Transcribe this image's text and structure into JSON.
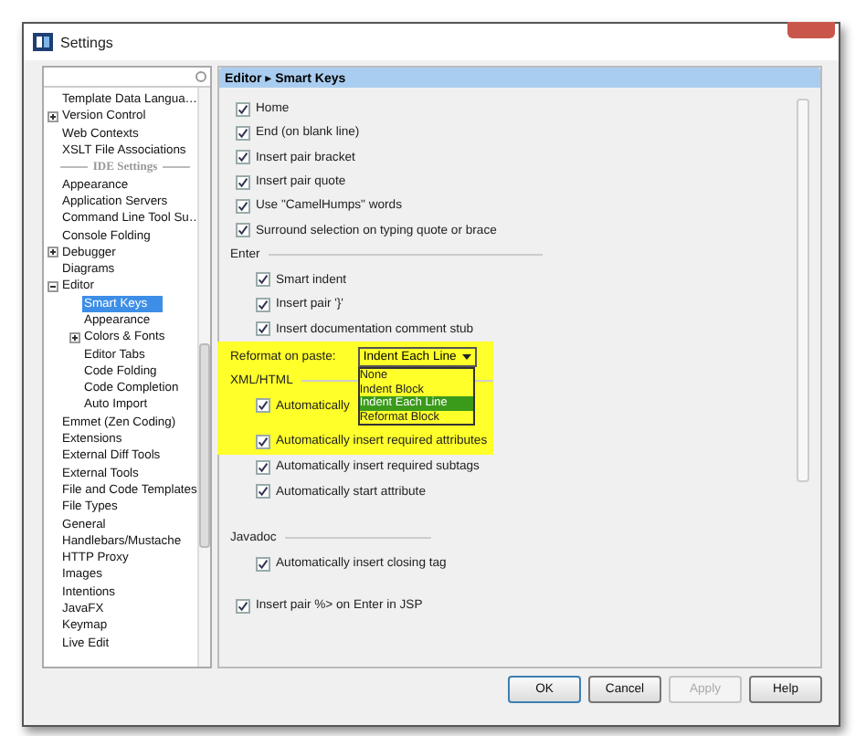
{
  "window": {
    "title": "Settings"
  },
  "sidebar": {
    "items": [
      {
        "kind": "item",
        "label": "Template Data Langua…",
        "selected": false
      },
      {
        "kind": "item",
        "label": "Version Control",
        "selected": false,
        "expanded": false,
        "has_children": true
      },
      {
        "kind": "item",
        "label": "Web Contexts",
        "selected": false
      },
      {
        "kind": "item",
        "label": "XSLT File Associations",
        "selected": false
      },
      {
        "kind": "separator",
        "label": "IDE Settings"
      },
      {
        "kind": "item",
        "label": "Appearance",
        "selected": false
      },
      {
        "kind": "item",
        "label": "Application Servers",
        "selected": false
      },
      {
        "kind": "item",
        "label": "Command Line Tool Su…",
        "selected": false
      },
      {
        "kind": "item",
        "label": "Console Folding",
        "selected": false
      },
      {
        "kind": "item",
        "label": "Debugger",
        "selected": false,
        "expanded": false,
        "has_children": true
      },
      {
        "kind": "item",
        "label": "Diagrams",
        "selected": false
      },
      {
        "kind": "item",
        "label": "Editor",
        "selected": false,
        "expanded": true,
        "has_children": true,
        "children": [
          {
            "kind": "item",
            "label": "Smart Keys",
            "selected": true
          },
          {
            "kind": "item",
            "label": "Appearance",
            "selected": false
          },
          {
            "kind": "item",
            "label": "Colors & Fonts",
            "selected": false,
            "expanded": false,
            "has_children": true
          },
          {
            "kind": "item",
            "label": "Editor Tabs",
            "selected": false
          },
          {
            "kind": "item",
            "label": "Code Folding",
            "selected": false
          },
          {
            "kind": "item",
            "label": "Code Completion",
            "selected": false
          },
          {
            "kind": "item",
            "label": "Auto Import",
            "selected": false
          }
        ]
      },
      {
        "kind": "item",
        "label": "Emmet (Zen Coding)",
        "selected": false
      },
      {
        "kind": "item",
        "label": "Extensions",
        "selected": false
      },
      {
        "kind": "item",
        "label": "External Diff Tools",
        "selected": false
      },
      {
        "kind": "item",
        "label": "External Tools",
        "selected": false
      },
      {
        "kind": "item",
        "label": "File and Code Templates",
        "selected": false
      },
      {
        "kind": "item",
        "label": "File Types",
        "selected": false
      },
      {
        "kind": "item",
        "label": "General",
        "selected": false
      },
      {
        "kind": "item",
        "label": "Handlebars/Mustache",
        "selected": false
      },
      {
        "kind": "item",
        "label": "HTTP Proxy",
        "selected": false
      },
      {
        "kind": "item",
        "label": "Images",
        "selected": false
      },
      {
        "kind": "item",
        "label": "Intentions",
        "selected": false
      },
      {
        "kind": "item",
        "label": "JavaFX",
        "selected": false
      },
      {
        "kind": "item",
        "label": "Keymap",
        "selected": false
      },
      {
        "kind": "item",
        "label": "Live Edit",
        "selected": false
      }
    ]
  },
  "content": {
    "breadcrumb": "Editor ▸ Smart Keys",
    "top_options": [
      {
        "label": "Home",
        "checked": true
      },
      {
        "label": "End (on blank line)",
        "checked": true
      },
      {
        "label": "Insert pair bracket",
        "checked": true
      },
      {
        "label": "Insert pair quote",
        "checked": true
      },
      {
        "label": "Use \"CamelHumps\" words",
        "checked": true
      },
      {
        "label": "Surround selection on typing quote or brace",
        "checked": true
      }
    ],
    "enter": {
      "title": "Enter",
      "options": [
        {
          "label": "Smart indent",
          "checked": true
        },
        {
          "label": "Insert pair '}'",
          "checked": true
        },
        {
          "label": "Insert documentation comment stub",
          "checked": true
        }
      ]
    },
    "reformat": {
      "label": "Reformat on paste:",
      "value": "Indent Each Line",
      "highlighted": true,
      "expanded": true,
      "options": [
        {
          "label": "None",
          "selected": false
        },
        {
          "label": "Indent Block",
          "selected": false
        },
        {
          "label": "Indent Each Line",
          "selected": true
        },
        {
          "label": "Reformat Block",
          "selected": false
        }
      ]
    },
    "xml_html": {
      "title": "XML/HTML",
      "options": [
        {
          "label": "Automatically",
          "checked": true
        },
        {
          "label": "Automatically insert required attributes",
          "checked": true
        },
        {
          "label": "Automatically insert required subtags",
          "checked": true
        },
        {
          "label": "Automatically start attribute",
          "checked": true
        }
      ]
    },
    "javadoc": {
      "title": "Javadoc",
      "options": [
        {
          "label": "Automatically insert closing tag",
          "checked": true
        }
      ]
    },
    "bottom_options": [
      {
        "label": "Insert pair %> on Enter in JSP",
        "checked": true
      }
    ]
  },
  "buttons": [
    {
      "label": "OK",
      "disabled": false,
      "default": true
    },
    {
      "label": "Cancel",
      "disabled": false,
      "default": false
    },
    {
      "label": "Apply",
      "disabled": true,
      "default": false
    },
    {
      "label": "Help",
      "disabled": false,
      "default": false
    }
  ]
}
